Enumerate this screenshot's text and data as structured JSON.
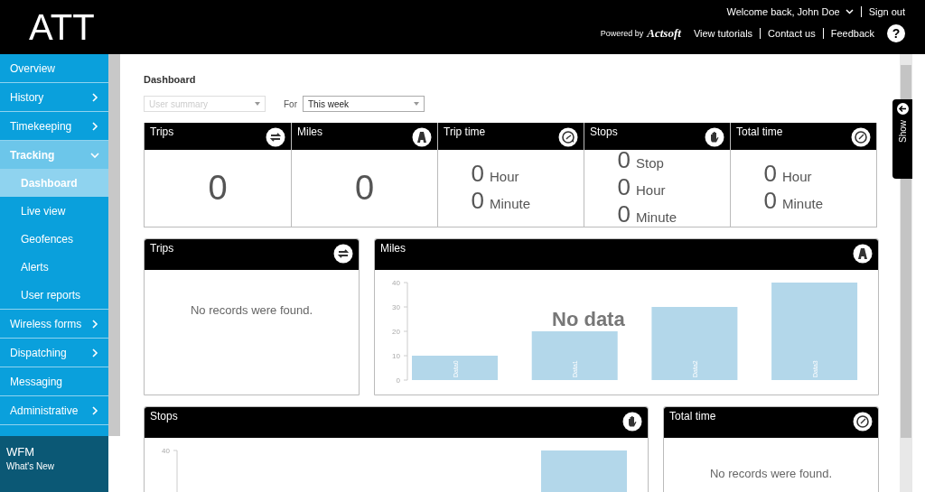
{
  "header": {
    "logo": "ATT",
    "welcome": "Welcome back, John Doe",
    "sign_out": "Sign out",
    "powered_by": "Powered by",
    "brand": "Actsoft",
    "links": [
      "View tutorials",
      "Contact us",
      "Feedback"
    ],
    "help": "?"
  },
  "sidebar": {
    "items": [
      {
        "label": "Overview",
        "expandable": false,
        "expanded": false
      },
      {
        "label": "History",
        "expandable": true,
        "expanded": false
      },
      {
        "label": "Timekeeping",
        "expandable": true,
        "expanded": false
      },
      {
        "label": "Tracking",
        "expandable": true,
        "expanded": true,
        "children": [
          {
            "label": "Dashboard",
            "selected": true
          },
          {
            "label": "Live view",
            "selected": false
          },
          {
            "label": "Geofences",
            "selected": false
          },
          {
            "label": "Alerts",
            "selected": false
          },
          {
            "label": "User reports",
            "selected": false
          }
        ]
      },
      {
        "label": "Wireless forms",
        "expandable": true,
        "expanded": false
      },
      {
        "label": "Dispatching",
        "expandable": true,
        "expanded": false
      },
      {
        "label": "Messaging",
        "expandable": false,
        "expanded": false
      },
      {
        "label": "Administrative",
        "expandable": true,
        "expanded": false
      }
    ],
    "footer": {
      "title": "WFM",
      "subtitle": "What's New"
    }
  },
  "page": {
    "title": "Dashboard",
    "filters": {
      "report": {
        "value": "User summary",
        "disabled": true
      },
      "for_label": "For",
      "period": {
        "value": "This week",
        "disabled": false
      }
    },
    "stat_cards": [
      {
        "title": "Trips",
        "kind": "trips",
        "value": "0"
      },
      {
        "title": "Miles",
        "kind": "miles",
        "value": "0"
      },
      {
        "title": "Trip time",
        "kind": "trip-time",
        "lines": [
          {
            "value": "0",
            "unit": "Hour"
          },
          {
            "value": "0",
            "unit": "Minute"
          }
        ]
      },
      {
        "title": "Stops",
        "kind": "stops",
        "lines": [
          {
            "value": "0",
            "unit": "Stop"
          },
          {
            "value": "0",
            "unit": "Hour"
          },
          {
            "value": "0",
            "unit": "Minute"
          }
        ]
      },
      {
        "title": "Total time",
        "kind": "total-time",
        "lines": [
          {
            "value": "0",
            "unit": "Hour"
          },
          {
            "value": "0",
            "unit": "Minute"
          }
        ]
      }
    ],
    "panels": [
      {
        "title": "Trips",
        "kind": "trips",
        "message": "No records were found."
      },
      {
        "title": "Miles",
        "kind": "miles",
        "overlay": "No data",
        "chart_data": {
          "type": "bar",
          "categories": [
            "Data0",
            "Data1",
            "Data2",
            "Data3"
          ],
          "values": [
            10,
            20,
            30,
            40
          ],
          "ylim": [
            0,
            40
          ],
          "yticks": [
            0,
            10,
            20,
            30,
            40
          ]
        }
      },
      {
        "title": "Stops",
        "kind": "stops",
        "tick_label": "40"
      },
      {
        "title": "Total time",
        "kind": "total-time",
        "message": "No records were found."
      }
    ]
  },
  "side_tab": {
    "label": "Show"
  }
}
